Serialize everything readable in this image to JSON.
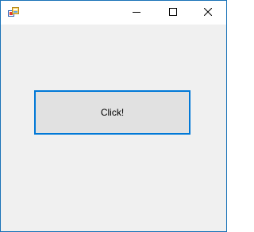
{
  "window": {
    "title": "",
    "icon": "winforms-app-icon",
    "border_color": "#1a73b8",
    "background": "#f0f0f0"
  },
  "titlebar": {
    "minimize_icon": "minimize-icon",
    "maximize_icon": "maximize-icon",
    "close_icon": "close-icon"
  },
  "main": {
    "button_label": "Click!",
    "button_border_color": "#0078d7",
    "button_fill": "#e1e1e1"
  }
}
